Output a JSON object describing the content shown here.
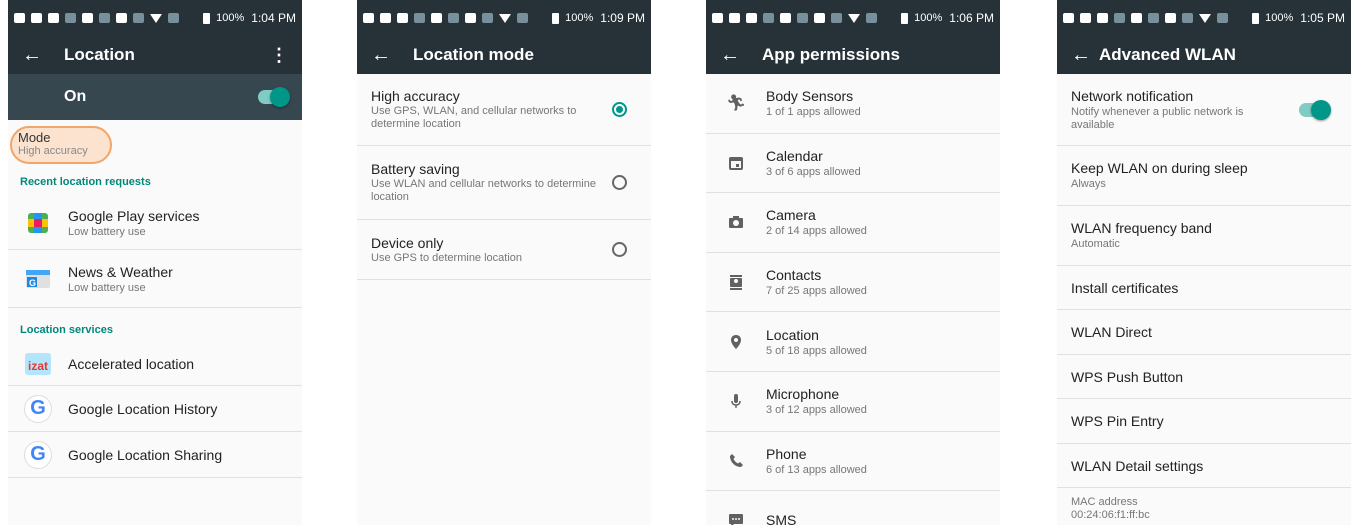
{
  "statusbar": {
    "battery": "100%",
    "times": [
      "1:04 PM",
      "1:09 PM",
      "1:06 PM",
      "1:05 PM"
    ]
  },
  "screen1": {
    "title": "Location",
    "switch_label": "On",
    "mode": {
      "title": "Mode",
      "value": "High accuracy"
    },
    "recent_header": "Recent location requests",
    "recent": [
      {
        "name": "Google Play services",
        "sub": "Low battery use"
      },
      {
        "name": "News & Weather",
        "sub": "Low battery use"
      }
    ],
    "services_header": "Location services",
    "services": [
      {
        "name": "Accelerated location"
      },
      {
        "name": "Google Location History"
      },
      {
        "name": "Google Location Sharing"
      }
    ]
  },
  "screen2": {
    "title": "Location mode",
    "options": [
      {
        "title": "High accuracy",
        "desc": "Use GPS, WLAN, and cellular networks to determine location",
        "selected": true
      },
      {
        "title": "Battery saving",
        "desc": "Use WLAN and cellular networks to determine location",
        "selected": false
      },
      {
        "title": "Device only",
        "desc": "Use GPS to determine location",
        "selected": false
      }
    ]
  },
  "screen3": {
    "title": "App permissions",
    "items": [
      {
        "name": "Body Sensors",
        "sub": "1 of 1 apps allowed",
        "icon": "body-sensors-icon"
      },
      {
        "name": "Calendar",
        "sub": "3 of 6 apps allowed",
        "icon": "calendar-icon"
      },
      {
        "name": "Camera",
        "sub": "2 of 14 apps allowed",
        "icon": "camera-icon"
      },
      {
        "name": "Contacts",
        "sub": "7 of 25 apps allowed",
        "icon": "contacts-icon"
      },
      {
        "name": "Location",
        "sub": "5 of 18 apps allowed",
        "icon": "location-pin-icon"
      },
      {
        "name": "Microphone",
        "sub": "3 of 12 apps allowed",
        "icon": "microphone-icon"
      },
      {
        "name": "Phone",
        "sub": "6 of 13 apps allowed",
        "icon": "phone-icon"
      },
      {
        "name": "SMS",
        "sub": "",
        "icon": "sms-icon"
      }
    ]
  },
  "screen4": {
    "title": "Advanced WLAN",
    "items": [
      {
        "name": "Network notification",
        "sub": "Notify whenever a public network is available"
      },
      {
        "name": "Keep WLAN on during sleep",
        "sub": "Always"
      },
      {
        "name": "WLAN frequency band",
        "sub": "Automatic"
      },
      {
        "name": "Install certificates",
        "sub": ""
      },
      {
        "name": "WLAN Direct",
        "sub": ""
      },
      {
        "name": "WPS Push Button",
        "sub": ""
      },
      {
        "name": "WPS Pin Entry",
        "sub": ""
      },
      {
        "name": "WLAN Detail settings",
        "sub": ""
      }
    ],
    "mac_label": "MAC address",
    "mac_value": "00:24:06:f1:ff:bc"
  },
  "colors": {
    "appbar": "#263238",
    "switchbar": "#37474f",
    "accent": "#009688",
    "highlight": "#f0a66a"
  }
}
